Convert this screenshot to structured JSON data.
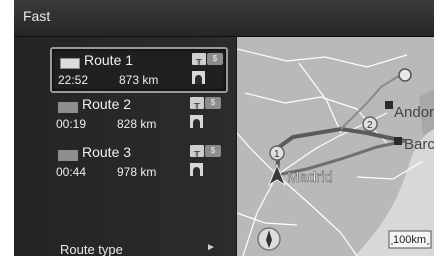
{
  "header": {
    "title": "Fast"
  },
  "routes": [
    {
      "name": "Route 1",
      "time": "22:52",
      "distance": "873 km",
      "selected": true
    },
    {
      "name": "Route 2",
      "time": "00:19",
      "distance": "828 km",
      "selected": false
    },
    {
      "name": "Route 3",
      "time": "00:44",
      "distance": "978 km",
      "selected": false
    }
  ],
  "route_type": {
    "label": "Route type",
    "arrow": "►"
  },
  "map": {
    "cities": [
      "Madrid",
      "Andorra",
      "Barcelona"
    ],
    "city_labels": {
      "madrid": "Madrid",
      "andorra": "Andor",
      "barcelona": "Barc"
    },
    "route_markers": {
      "r1": "1",
      "r2": "2"
    },
    "scale": "100km"
  },
  "icons": {
    "highway": "highway-icon",
    "toll": "toll-icon",
    "tunnel": "tunnel-icon",
    "compass": "compass-icon",
    "destination_pin": "destination-pin-icon",
    "position": "vehicle-position-icon"
  },
  "colors": {
    "background": "#1a1a1a",
    "land": "#b9b9b9",
    "sea": "#d8d8d8",
    "roads": "#ffffff",
    "route": "#5a5a5a"
  }
}
